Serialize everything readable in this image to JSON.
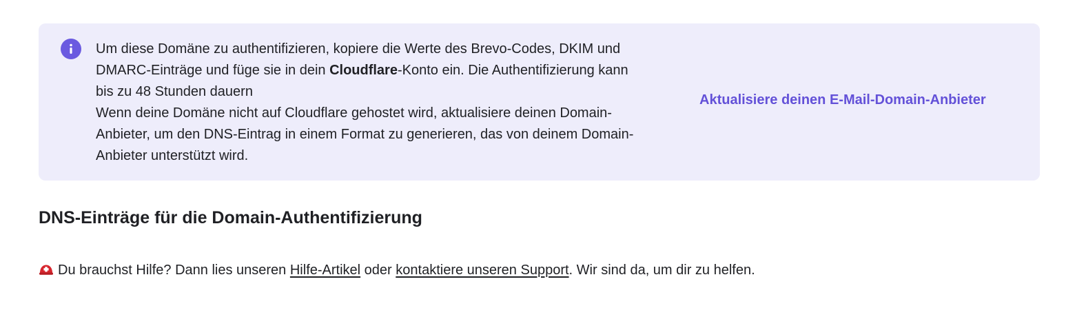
{
  "banner": {
    "icon": "info-icon",
    "accent_color": "#6a5ae0",
    "text_part1": "Um diese Domäne zu authentifizieren, kopiere die Werte des Brevo-Codes, DKIM und",
    "text_part2_prefix": "DMARC-Einträge und füge sie in dein ",
    "text_part2_bold": "Cloudflare",
    "text_part2_suffix": "-Konto ein. Die Authentifizierung kann",
    "text_part3": "bis zu 48 Stunden dauern",
    "text_part4": "Wenn deine Domäne nicht auf Cloudflare gehostet wird, aktualisiere deinen Domain-",
    "text_part5": "Anbieter, um den DNS-Eintrag in einem Format zu generieren, das von deinem Domain-",
    "text_part6": "Anbieter unterstützt wird.",
    "link_label": "Aktualisiere deinen E-Mail-Domain-Anbieter"
  },
  "section": {
    "title": "DNS-Einträge für die Domain-Authentifizierung"
  },
  "help": {
    "icon": "rescue-helmet-icon",
    "prefix": "Du brauchst Hilfe? Dann lies unseren ",
    "article_link": "Hilfe-Artikel",
    "middle": " oder ",
    "support_link": "kontaktiere unseren Support",
    "suffix": ". Wir sind da, um dir zu helfen."
  }
}
